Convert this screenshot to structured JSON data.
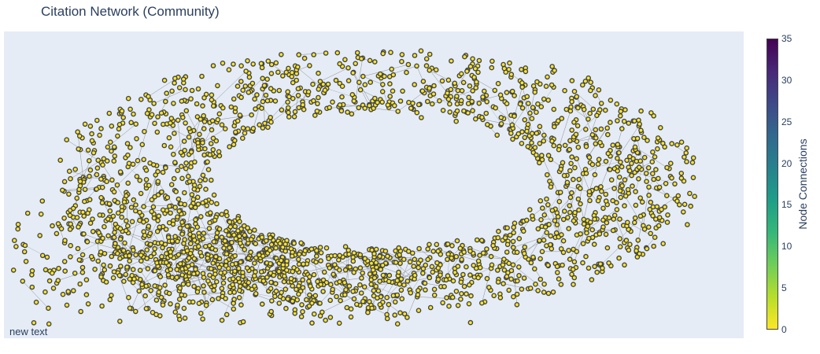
{
  "chart_data": {
    "type": "scatter",
    "subtype": "network-graph",
    "title": "Citation Network (Community)",
    "annotation": "new text",
    "colorbar": {
      "title": "Node Connections",
      "min": 0,
      "max": 35,
      "ticks": [
        0,
        5,
        10,
        15,
        20,
        25,
        30,
        35
      ],
      "colorscale": [
        "#fde725",
        "#b5de2b",
        "#6ece58",
        "#35b779",
        "#1f9e89",
        "#26828e",
        "#31688e",
        "#3e4989",
        "#482878",
        "#440154"
      ]
    },
    "nodes": {
      "marker_fill": "#fde725",
      "marker_outline": "#444444",
      "connection_range": [
        0,
        3
      ]
    },
    "edges": {
      "color": "#888888"
    },
    "axes": {
      "showgrid": false,
      "showticklabels": false
    },
    "plot_background": "#e5ecf6",
    "legend": "none"
  }
}
